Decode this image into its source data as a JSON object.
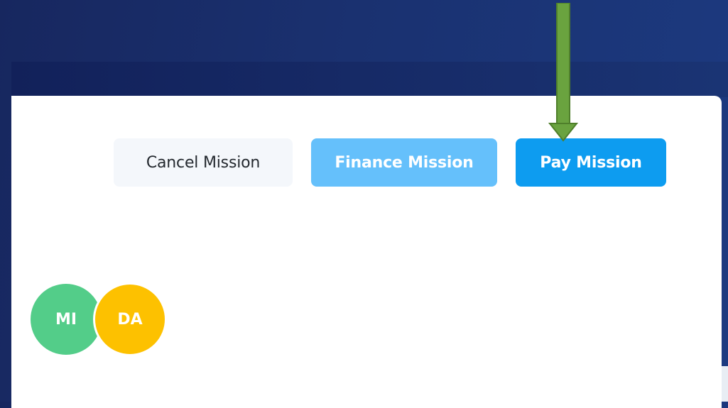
{
  "actions": {
    "cancel_label": "Cancel Mission",
    "finance_label": "Finance Mission",
    "pay_label": "Pay Mission"
  },
  "participants": [
    {
      "initials": "MI",
      "color": "#53cd89"
    },
    {
      "initials": "DA",
      "color": "#fdc100"
    }
  ],
  "colors": {
    "background": "#1a3170",
    "card": "#ffffff",
    "cancel_bg": "#f4f7fb",
    "finance_bg": "#65c0fb",
    "pay_bg": "#0d9cf0",
    "annotation_arrow": "#6aa33f"
  },
  "annotation": {
    "icon": "down-arrow-icon"
  }
}
